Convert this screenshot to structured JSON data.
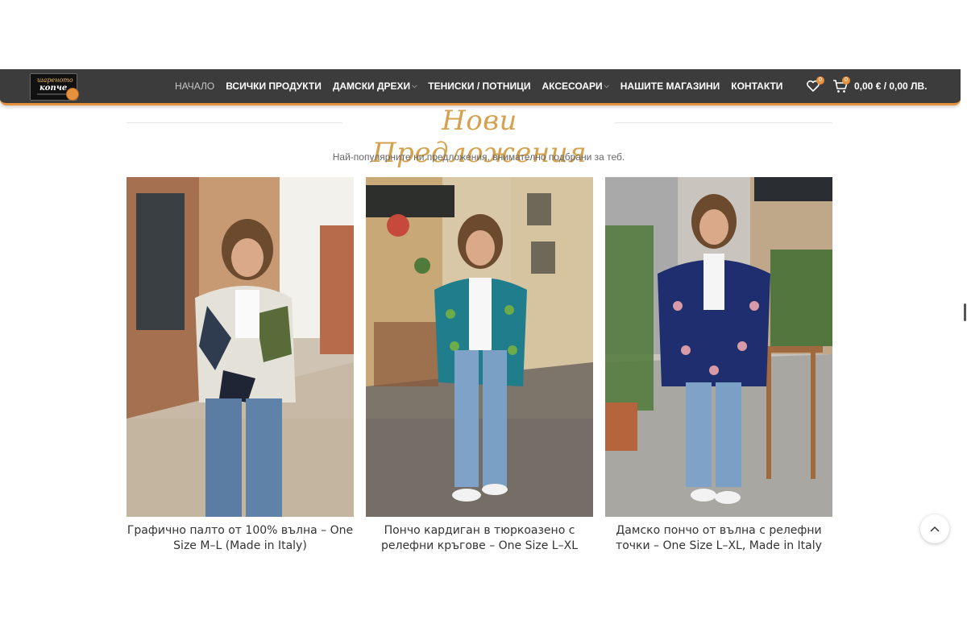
{
  "header": {
    "logo_text_top": "шареното",
    "logo_text_main": "копче",
    "nav": [
      {
        "label": "НАЧАЛО",
        "active": true,
        "dropdown": false
      },
      {
        "label": "ВСИЧКИ ПРОДУКТИ",
        "active": false,
        "dropdown": false
      },
      {
        "label": "ДАМСКИ ДРЕХИ",
        "active": false,
        "dropdown": true
      },
      {
        "label": "ТЕНИСКИ / ПОТНИЦИ",
        "active": false,
        "dropdown": false
      },
      {
        "label": "АКСЕСОАРИ",
        "active": false,
        "dropdown": true
      },
      {
        "label": "НАШИТЕ МАГАЗИНИ",
        "active": false,
        "dropdown": false
      },
      {
        "label": "КОНТАКТИ",
        "active": false,
        "dropdown": false
      }
    ],
    "wishlist_count": "0",
    "cart_count": "0",
    "cart_total": "0,00 € / 0,00 ЛВ.",
    "accent_color": "#e6913d",
    "bg_color": "#3c3c3c"
  },
  "section": {
    "title": "Нови Предложения",
    "subtitle": "Най-популярните ни предложения, внимателно подбрани за теб.",
    "title_color": "#d4a24e"
  },
  "products": [
    {
      "name": "Графично палто от 100% вълна – One Size M–L (Made in Italy)",
      "garment": "graphic-wool-coat"
    },
    {
      "name": "Пончо кардиган в тюркоазено с релефни кръгове – One Size L–XL",
      "garment": "turquoise-poncho-cardigan"
    },
    {
      "name": "Дамско пончо от вълна с релефни точки – One Size L–XL, Made in Italy",
      "garment": "navy-dotted-poncho"
    }
  ],
  "icons": {
    "wishlist": "heart-icon",
    "cart": "cart-icon",
    "scroll_top": "chevron-up-icon"
  }
}
